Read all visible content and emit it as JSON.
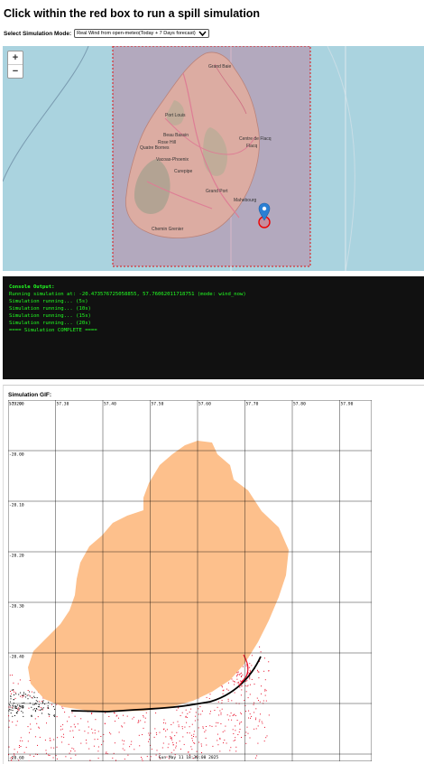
{
  "page": {
    "title": "Click within the red box to run a spill simulation"
  },
  "mode": {
    "label": "Select Simulation Mode:",
    "selected": "Real Wind from open-meteo(Today + 7 Days forecast)",
    "icon": "chevron-down-icon"
  },
  "map": {
    "zoom_in": "+",
    "zoom_out": "−",
    "labels": [
      "Port Louis",
      "Beau Bassin",
      "Rose Hill",
      "Vacoas-Phoenix",
      "Quatre Bornes",
      "Curepipe",
      "Grand Port",
      "Mahebourg",
      "Chemin Grenier",
      "Flacq",
      "Centre de Flacq",
      "Grand Baie"
    ],
    "marker_icon": "map-pin-icon"
  },
  "console": {
    "header": "Console Output:",
    "lines": [
      "Running simulation at: -20.473576725058855, 57.76062011718751 (mode: wind_now)",
      "Simulation running... (5s)",
      "Simulation running... (10s)",
      "Simulation running... (15s)",
      "Simulation running... (20s)",
      "==== Simulation COMPLETE ===="
    ]
  },
  "gif": {
    "label": "Simulation GIF:",
    "x_ticks": [
      "57.20",
      "57.30",
      "57.40",
      "57.50",
      "57.60",
      "57.70",
      "57.80",
      "57.90"
    ],
    "y_ticks": [
      "-19.90",
      "-20.00",
      "-20.10",
      "-20.20",
      "-20.30",
      "-20.40",
      "-20.50",
      "-20.60"
    ],
    "timestamp": "Sun May 11 18:30:00 2025",
    "colors": {
      "land": "#fdc08c",
      "particles": "#e8102a",
      "stranded": "#000000"
    }
  }
}
